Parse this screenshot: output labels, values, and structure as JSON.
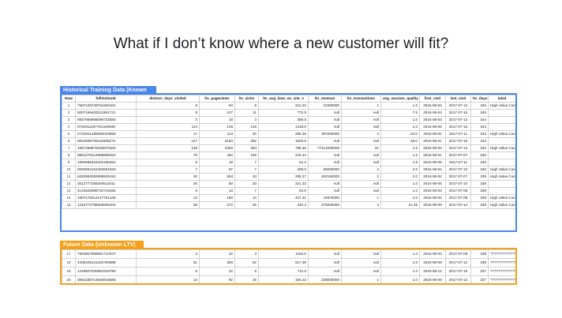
{
  "slide": {
    "title": "What if I don’t know where a new customer will fit?"
  },
  "historical": {
    "label": "Historical Training Data (Known LTV)",
    "columns": [
      "Row",
      "fullVisitorId",
      "distinct_days_visited",
      "ltv_pageviews",
      "ltv_visits",
      "ltv_avg_time_on_site_s",
      "ltv_revenue",
      "ltv_transactions",
      "avg_session_quality",
      "first_visit",
      "last_visit",
      "ltv_days",
      "label"
    ],
    "rows": [
      [
        "1",
        "7587138749751940102",
        "9",
        "94",
        "9",
        "312.33",
        "24380000",
        "1",
        "1.0",
        "2016-08-03",
        "2017-07-14",
        "345",
        "High Value Customer"
      ],
      [
        "2",
        "6007196403211981721",
        "8",
        "147",
        "11",
        "772.5",
        "null",
        "null",
        "7.5",
        "2016-08-04",
        "2017-07-15",
        "345",
        ""
      ],
      [
        "3",
        "9557969866096732580",
        "3",
        "18",
        "3",
        "356.5",
        "null",
        "null",
        "1.0",
        "2016-08-03",
        "2017-07-13",
        "344",
        ""
      ],
      [
        "4",
        "0720311197761340948",
        "114",
        "148",
        "146",
        "2118.0",
        "null",
        "null",
        "1.0",
        "2016-08-05",
        "2017-07-15",
        "344",
        ""
      ],
      [
        "5",
        "2742841486650042868",
        "17",
        "113",
        "20",
        "286.28",
        "387000000",
        "2",
        "23.0",
        "2016-08-02",
        "2017-07-11",
        "343",
        "High Value Customer"
      ],
      [
        "6",
        "0824839726118485274",
        "127",
        "3153",
        "282",
        "1520.0",
        "null",
        "null",
        "26.0",
        "2016-08-01",
        "2017-07-10",
        "343",
        ""
      ],
      [
        "7",
        "1957458976293878100",
        "148",
        "4303",
        "284",
        "796.46",
        "77113430000",
        "22",
        "1.5",
        "2016-08-04",
        "2017-07-12",
        "342",
        "High Value Customer"
      ],
      [
        "8",
        "9801275214968695322",
        "79",
        "462",
        "106",
        "219.44",
        "null",
        "null",
        "1.5",
        "2016-08-01",
        "2017-07-07",
        "340",
        ""
      ],
      [
        "9",
        "1950585318332186454",
        "6",
        "19",
        "7",
        "51.4",
        "null",
        "null",
        "1.5",
        "2016-08-05",
        "2017-07-11",
        "340",
        ""
      ],
      [
        "10",
        "0084834161383601528",
        "7",
        "97",
        "7",
        "258.0",
        "69260000",
        "2",
        "2.0",
        "2016-08-04",
        "2017-07-10",
        "340",
        "High Value Customer"
      ],
      [
        "11",
        "6283984083898925152",
        "40",
        "553",
        "43",
        "285.37",
        "462190000",
        "2",
        "2.0",
        "2016-08-02",
        "2017-07-07",
        "339",
        "High Value Customer"
      ],
      [
        "12",
        "3512777258200611611",
        "20",
        "60",
        "20",
        "221.33",
        "null",
        "null",
        "1.0",
        "2016-08-05",
        "2017-07-10",
        "339",
        ""
      ],
      [
        "13",
        "4143626096732715494",
        "6",
        "13",
        "7",
        "52.5",
        "null",
        "null",
        "1.0",
        "2016-08-03",
        "2017-07-08",
        "339",
        ""
      ],
      [
        "14",
        "1907175312147751345",
        "13",
        "180",
        "14",
        "427.21",
        "44970000",
        "1",
        "2.0",
        "2016-08-03",
        "2017-07-08",
        "339",
        "High Value Customer"
      ],
      [
        "15",
        "1315772786606606104",
        "28",
        "272",
        "36",
        "340.3",
        "279320000",
        "3",
        "21.25",
        "2016-08-09",
        "2017-07-14",
        "339",
        "High Value Customer"
      ]
    ]
  },
  "future": {
    "label": "Future Data (Unknown LTV)",
    "rows": [
      [
        "17",
        "7904807959681747547",
        "3",
        "42",
        "3",
        "1162.0",
        "null",
        "null",
        "1.0",
        "2016-08-03",
        "2017-07-09",
        "338",
        "????????????????????"
      ],
      [
        "18",
        "4405445121320750986",
        "51",
        "358",
        "62",
        "517.36",
        "null",
        "null",
        "1.0",
        "2016-08-08",
        "2017-07-12",
        "338",
        "????????????????????"
      ],
      [
        "19",
        "1419607020881916790",
        "5",
        "22",
        "5",
        "711.0",
        "null",
        "null",
        "1.0",
        "2016-08-12",
        "2017-07-15",
        "337",
        "????????????????????"
      ],
      [
        "20",
        "3862335714593915688",
        "13",
        "92",
        "16",
        "154.23",
        "238000000",
        "1",
        "2.0",
        "2016-08-09",
        "2017-07-12",
        "337",
        "????????????????????"
      ]
    ]
  },
  "colors": {
    "historical_accent": "#4a86e8",
    "future_accent": "#f6a01a"
  }
}
